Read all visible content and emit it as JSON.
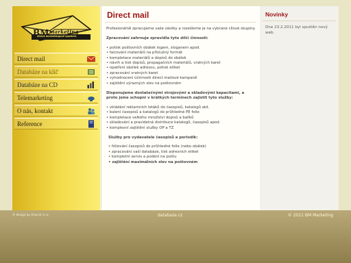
{
  "logo": {
    "bm": "BM",
    "marketing": "marketing",
    "subtitle": "direct marketingové sputiers"
  },
  "nav": {
    "items": [
      {
        "label": "Direct mail",
        "icon": "envelope-icon"
      },
      {
        "label": "Databáze na klíč",
        "icon": "database-key-icon"
      },
      {
        "label": "Databáze na CD",
        "icon": "bar-chart-icon"
      },
      {
        "label": "Telemarketing",
        "icon": "telephone-icon"
      },
      {
        "label": "O nás, kontakt",
        "icon": "people-icon"
      },
      {
        "label": "Reference",
        "icon": "book-icon"
      }
    ]
  },
  "main": {
    "title": "Direct mail",
    "intro": "Profesionálně zpracujeme vaše zásilky a rozešleme je na vybrané cílové skupiny.",
    "section1": {
      "heading": "Zpracování zahrnuje zpravidla tyto dílčí činnosti:",
      "items": [
        "• potisk poštovních obálek logem, sloganem apod.",
        "• falcování materiálů na příslušný formát",
        "• kompletace materiálů a dopisů do obálek",
        "• návrh a tisk dopisů, propagačních materiálů, vratných karet",
        "• opatření zásilek adresou, potisk etiket",
        "• zpracování vratných karet",
        "• vyhodnocení účinnosti direct mailové kampaně",
        "• zajištění výrazných slev na poštovném"
      ]
    },
    "section2": {
      "heading": "Disponujeme dostatečnými strojovými a skladovými kapacitami, a proto jsme schopni v krátkých termínech zajistit tyto služby:",
      "items": [
        "• vkládání reklamních letáků do časopisů, katalogů atd.",
        "• balení časopisů a katalogů do průhledné PE folie",
        "• kompletace velkého množství dopisů a balíků",
        "• skladování a pravidelná distribuce katalogů, časopisů apod.",
        "• komplexní zajištění služby OP a TZ"
      ]
    },
    "section3": {
      "heading": "Služby pro vydavatele časopisů a periodik:",
      "items": [
        "• fóliování časopisů do průhledné folie (nebo obálek)",
        "• zpracování vaší databáze, tisk adresních etiket",
        "• kompletní servis a podání na poštu"
      ],
      "bold_item": "• zajištění maximálních slev na poštovném"
    }
  },
  "sidebar_right": {
    "title": "Novinky",
    "news": "Dne 23.2.2011 byl spuštěn nový web."
  },
  "footer": {
    "design": "© design by Anuruh s.r.o.",
    "site": "databaze.cz",
    "copyright": "© 2011 BM Marketing"
  },
  "colors": {
    "accent_red": "#9a1414",
    "gold": "#f3dc4a",
    "footer_brown": "#8d7e4c"
  }
}
